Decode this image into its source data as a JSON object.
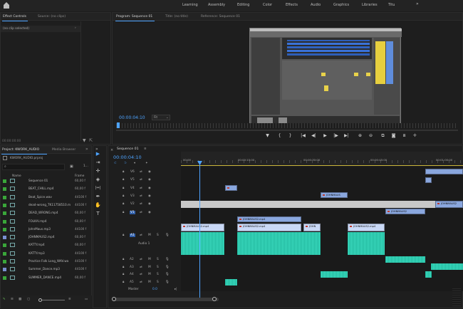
{
  "header": {
    "workspaces": [
      "Learning",
      "Assembly",
      "Editing",
      "Color",
      "Effects",
      "Audio",
      "Graphics",
      "Libraries",
      "Titu"
    ],
    "more": "»"
  },
  "source_panel": {
    "tabs": [
      "Effect Controls",
      "Source: (no clips)"
    ],
    "menu": "≡",
    "no_clip": "(no clip selected)",
    "timecode": "00:00:00:00"
  },
  "program_panel": {
    "tabs": [
      "Program: Sequence 01",
      "Title: (no title)",
      "Reference: Sequence 01"
    ],
    "timecode": "00:00:04:10",
    "fit": "Fit",
    "controls": [
      "▼",
      "{",
      "}",
      "|◀",
      "◀|",
      "◀",
      "▶",
      "|▶",
      "▶|",
      "⊕",
      "⊖",
      "⧉",
      "📷",
      "⧈",
      "✛"
    ]
  },
  "project_panel": {
    "tabs": [
      "Project: KWORK_AUDIO",
      "Media Browser"
    ],
    "more": "»",
    "file": "KWORK_AUDIO.prproj",
    "count": "1...",
    "col_name": "Name",
    "col_frame": "Frame",
    "items": [
      {
        "name": "Sequence 01",
        "frame": "60,00 f",
        "color": "#3aa63a"
      },
      {
        "name": "BEAT_CHILL.mp4",
        "frame": "60,00 f",
        "color": "#3aa63a"
      },
      {
        "name": "Beat_Spice.wav",
        "frame": "44100 f",
        "color": "#3aa63a"
      },
      {
        "name": "dead-wrong_TK11758510.m",
        "frame": "44100 f",
        "color": "#3aa63a"
      },
      {
        "name": "DEAD_WRONG.mp4",
        "frame": "60,00 f",
        "color": "#3aa63a"
      },
      {
        "name": "FOLKAl.mp4",
        "frame": "60,00 f",
        "color": "#3aa63a"
      },
      {
        "name": "JohnMaus.mp3",
        "frame": "44100 f",
        "color": "#3aa63a"
      },
      {
        "name": "JOHNMAUS2.mp4",
        "frame": "60,00 f",
        "color": "#7a8fd1"
      },
      {
        "name": "KATTY.mp4",
        "frame": "60,00 f",
        "color": "#3aa63a"
      },
      {
        "name": "KATTY.mp3",
        "frame": "44100 f",
        "color": "#3aa63a"
      },
      {
        "name": "Practice Folk Long_WAV.wa",
        "frame": "44100 f",
        "color": "#3aa63a"
      },
      {
        "name": "Summer_Dance.mp3",
        "frame": "44100 f",
        "color": "#7a8fd1"
      },
      {
        "name": "SUMMER_DANCE.mp4",
        "frame": "60,00 f",
        "color": "#3aa63a"
      }
    ]
  },
  "tools": [
    "▶",
    "⇥",
    "✛",
    "◈",
    "|↔|",
    "✒",
    "✋",
    "T"
  ],
  "timeline": {
    "tab": "Sequence 01",
    "timecode": "00:00:04:10",
    "ruler": [
      "00:00",
      "00:00:15:00",
      "00:00:30:00",
      "00:00:45:00",
      "00:01:00:00"
    ],
    "video_tracks": [
      "V6",
      "V5",
      "V4",
      "V3",
      "V2",
      "V1"
    ],
    "audio_tracks": [
      "A1",
      "A2",
      "A3",
      "A4",
      "A5"
    ],
    "audio1_name": "Audio 1",
    "master": "Master",
    "master_val": "0.0",
    "clips": {
      "v4": "JOHNMAUS",
      "v3": "JOHNMAUS2",
      "v2a": "JOHNMAUS2.mp4",
      "v2b": "JOHNMAUS2.mp4",
      "v1a": "JOHNMAUS2.mp4",
      "v1b": "JOHN",
      "v1c": "JOHNMAUS2.mp4",
      "v1d": "JOHNMAUS2.mp4"
    }
  },
  "colors": {
    "accent": "#4da3ff",
    "video_clip": "#8aa7de",
    "audio_clip": "#2ecfb0"
  }
}
